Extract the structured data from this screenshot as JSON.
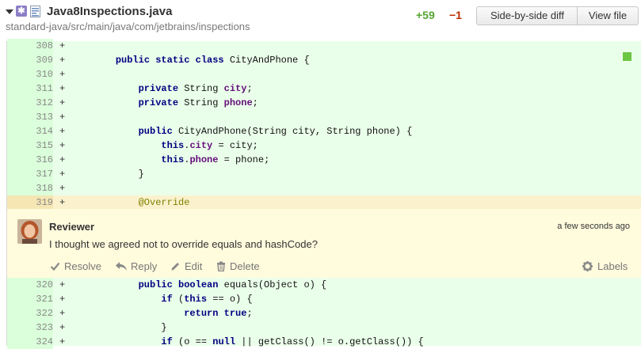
{
  "file": {
    "name": "Java8Inspections.java",
    "path": "standard-java/src/main/java/com/jetbrains/inspections",
    "added": "+59",
    "removed": "−1",
    "mod_badge": "✱",
    "buttons": {
      "side_by_side": "Side-by-side diff",
      "view_file": "View file"
    }
  },
  "diff_lines_before": [
    {
      "num": "308",
      "sign": "+",
      "tokens": []
    },
    {
      "num": "309",
      "sign": "+",
      "tokens": [
        {
          "t": "    "
        },
        {
          "t": "public static class",
          "c": "kw"
        },
        {
          "t": " CityAndPhone {"
        }
      ]
    },
    {
      "num": "310",
      "sign": "+",
      "tokens": []
    },
    {
      "num": "311",
      "sign": "+",
      "tokens": [
        {
          "t": "        "
        },
        {
          "t": "private",
          "c": "kw"
        },
        {
          "t": " String "
        },
        {
          "t": "city",
          "c": "fld"
        },
        {
          "t": ";"
        }
      ]
    },
    {
      "num": "312",
      "sign": "+",
      "tokens": [
        {
          "t": "        "
        },
        {
          "t": "private",
          "c": "kw"
        },
        {
          "t": " String "
        },
        {
          "t": "phone",
          "c": "fld"
        },
        {
          "t": ";"
        }
      ]
    },
    {
      "num": "313",
      "sign": "+",
      "tokens": []
    },
    {
      "num": "314",
      "sign": "+",
      "tokens": [
        {
          "t": "        "
        },
        {
          "t": "public",
          "c": "kw"
        },
        {
          "t": " CityAndPhone(String city, String phone) {"
        }
      ]
    },
    {
      "num": "315",
      "sign": "+",
      "tokens": [
        {
          "t": "            "
        },
        {
          "t": "this",
          "c": "kw"
        },
        {
          "t": "."
        },
        {
          "t": "city",
          "c": "fld"
        },
        {
          "t": " = city;"
        }
      ]
    },
    {
      "num": "316",
      "sign": "+",
      "tokens": [
        {
          "t": "            "
        },
        {
          "t": "this",
          "c": "kw"
        },
        {
          "t": "."
        },
        {
          "t": "phone",
          "c": "fld"
        },
        {
          "t": " = phone;"
        }
      ]
    },
    {
      "num": "317",
      "sign": "+",
      "tokens": [
        {
          "t": "        }"
        }
      ]
    },
    {
      "num": "318",
      "sign": "+",
      "tokens": []
    },
    {
      "num": "319",
      "sign": "+",
      "highlight": true,
      "tokens": [
        {
          "t": "        "
        },
        {
          "t": "@Override",
          "c": "ann"
        }
      ]
    }
  ],
  "comment": {
    "author": "Reviewer",
    "time": "a few seconds ago",
    "text": "I thought we agreed not to override equals and hashCode?",
    "actions": {
      "resolve": "Resolve",
      "reply": "Reply",
      "edit": "Edit",
      "delete": "Delete",
      "labels": "Labels"
    }
  },
  "diff_lines_after": [
    {
      "num": "320",
      "sign": "+",
      "tokens": [
        {
          "t": "        "
        },
        {
          "t": "public boolean",
          "c": "kw"
        },
        {
          "t": " equals(Object o) {"
        }
      ]
    },
    {
      "num": "321",
      "sign": "+",
      "tokens": [
        {
          "t": "            "
        },
        {
          "t": "if",
          "c": "kw"
        },
        {
          "t": " ("
        },
        {
          "t": "this",
          "c": "kw"
        },
        {
          "t": " == o) {"
        }
      ]
    },
    {
      "num": "322",
      "sign": "+",
      "tokens": [
        {
          "t": "                "
        },
        {
          "t": "return true",
          "c": "kw"
        },
        {
          "t": ";"
        }
      ]
    },
    {
      "num": "323",
      "sign": "+",
      "tokens": [
        {
          "t": "            }"
        }
      ]
    },
    {
      "num": "324",
      "sign": "+",
      "tokens": [
        {
          "t": "            "
        },
        {
          "t": "if",
          "c": "kw"
        },
        {
          "t": " (o == "
        },
        {
          "t": "null",
          "c": "kw"
        },
        {
          "t": " || getClass() != o.getClass()) {"
        }
      ]
    }
  ],
  "colors": {
    "added_bg": "#eaffea",
    "gutter_bg": "#dbffdb",
    "highlight_bg": "#fbf2cd",
    "comment_bg": "#fffbdd",
    "added_count": "#55a532",
    "removed_count": "#bd2c00"
  },
  "icons": [
    "collapse-caret-icon",
    "modified-badge-icon",
    "file-icon",
    "check-icon",
    "reply-icon",
    "pencil-icon",
    "trash-icon",
    "gear-icon"
  ]
}
